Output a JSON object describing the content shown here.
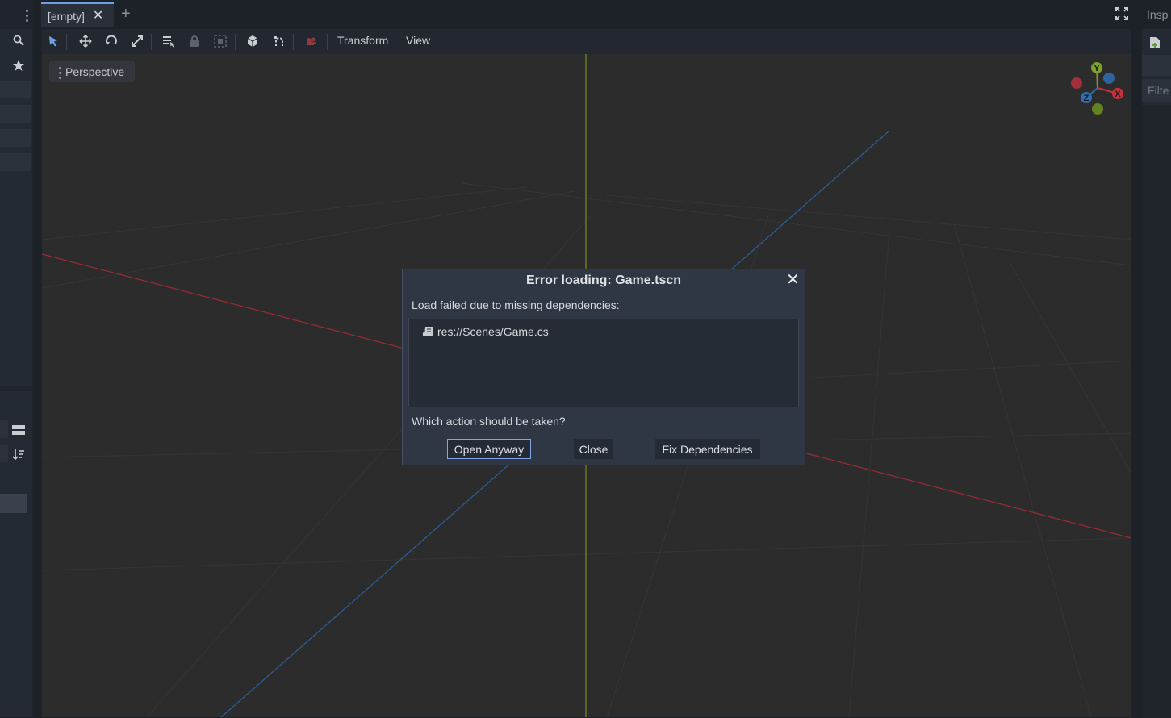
{
  "editor": {
    "scene_tab": {
      "label": "[empty]",
      "close_glyph": "✕"
    },
    "add_tab_glyph": "+",
    "toolbar": {
      "tools": [
        "select-icon",
        "move-icon",
        "rotate-icon",
        "scale-icon",
        "list-select-icon",
        "lock-icon",
        "group-icon",
        "local-space-icon",
        "snap-icon",
        "camera-preview-icon"
      ],
      "menus": {
        "transform": "Transform",
        "view": "View"
      }
    },
    "viewport": {
      "mode_label": "Perspective",
      "gizmo": {
        "x": "X",
        "y": "Y",
        "z": "Z"
      }
    },
    "right_dock": {
      "tab_label": "Insp",
      "filter_placeholder": "Filte"
    },
    "colors": {
      "accent": "#6f9fe3",
      "x_axis": "#c9303e",
      "y_axis": "#7ea12c",
      "z_axis": "#2f6fb3"
    }
  },
  "dialog": {
    "title": "Error loading: Game.tscn",
    "close_glyph": "✕",
    "message": "Load failed due to missing dependencies:",
    "dependencies": [
      {
        "icon": "script-icon",
        "path": "res://Scenes/Game.cs"
      }
    ],
    "question": "Which action should be taken?",
    "buttons": {
      "open_anyway": "Open Anyway",
      "close": "Close",
      "fix_dependencies": "Fix Dependencies"
    }
  }
}
